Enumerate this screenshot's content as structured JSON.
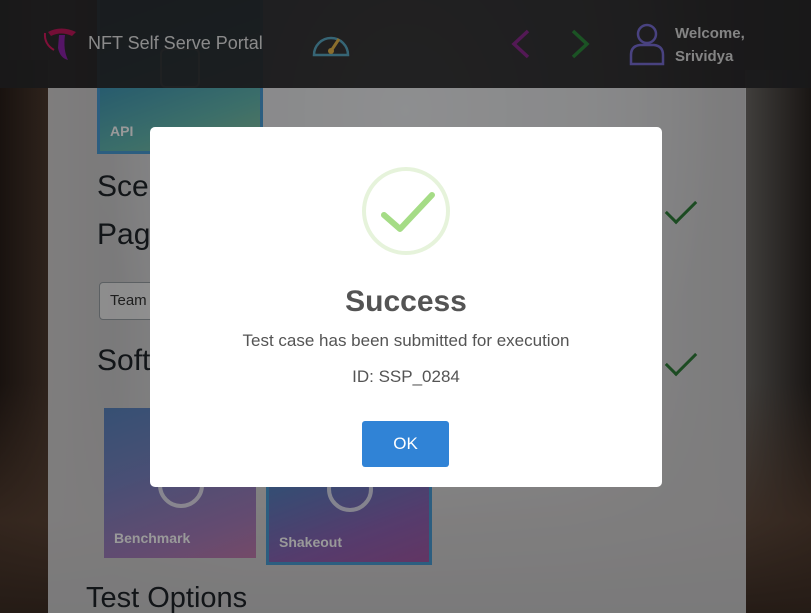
{
  "header": {
    "app_title": "NFT Self Serve Portal",
    "welcome_line1": "Welcome,",
    "welcome_line2": "Srividya",
    "icons": [
      "telstra-logo-icon",
      "gauge-icon",
      "chevron-left-icon",
      "chevron-right-icon",
      "user-icon"
    ]
  },
  "page": {
    "tiles": {
      "api": "API",
      "benchmark": "Benchmark",
      "shakeout": "Shakeout"
    },
    "headings": {
      "scenario_partial": "Sce",
      "page_partial": "Pag",
      "software_partial": "Soft",
      "test_options": "Test Options"
    },
    "team_field_partial": "Team"
  },
  "modal": {
    "title": "Success",
    "message": "Test case has been submitted for execution",
    "id_text": "ID: SSP_0284",
    "ok_label": "OK"
  },
  "colors": {
    "header_bg": "#2a2a2c",
    "ok_button": "#3083d6",
    "success_check": "#a5dc86",
    "nav_prev": "#8b2a8e",
    "nav_next": "#2e8a3c"
  }
}
